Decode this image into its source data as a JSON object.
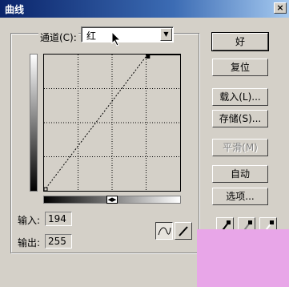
{
  "window": {
    "title": "曲线",
    "close_label": "×"
  },
  "channel": {
    "label": "通道(C):",
    "value": "红"
  },
  "curve": {
    "points": [
      [
        0,
        0
      ],
      [
        255,
        255
      ]
    ],
    "input_label": "输入:",
    "input_value": "194",
    "output_label": "输出:",
    "output_value": "255"
  },
  "buttons": {
    "ok": "好",
    "reset": "复位",
    "load": "载入(L)...",
    "save": "存储(S)...",
    "smooth": "平滑(M)",
    "auto": "自动",
    "options": "选项..."
  },
  "gradient_toggle": "◀▶"
}
